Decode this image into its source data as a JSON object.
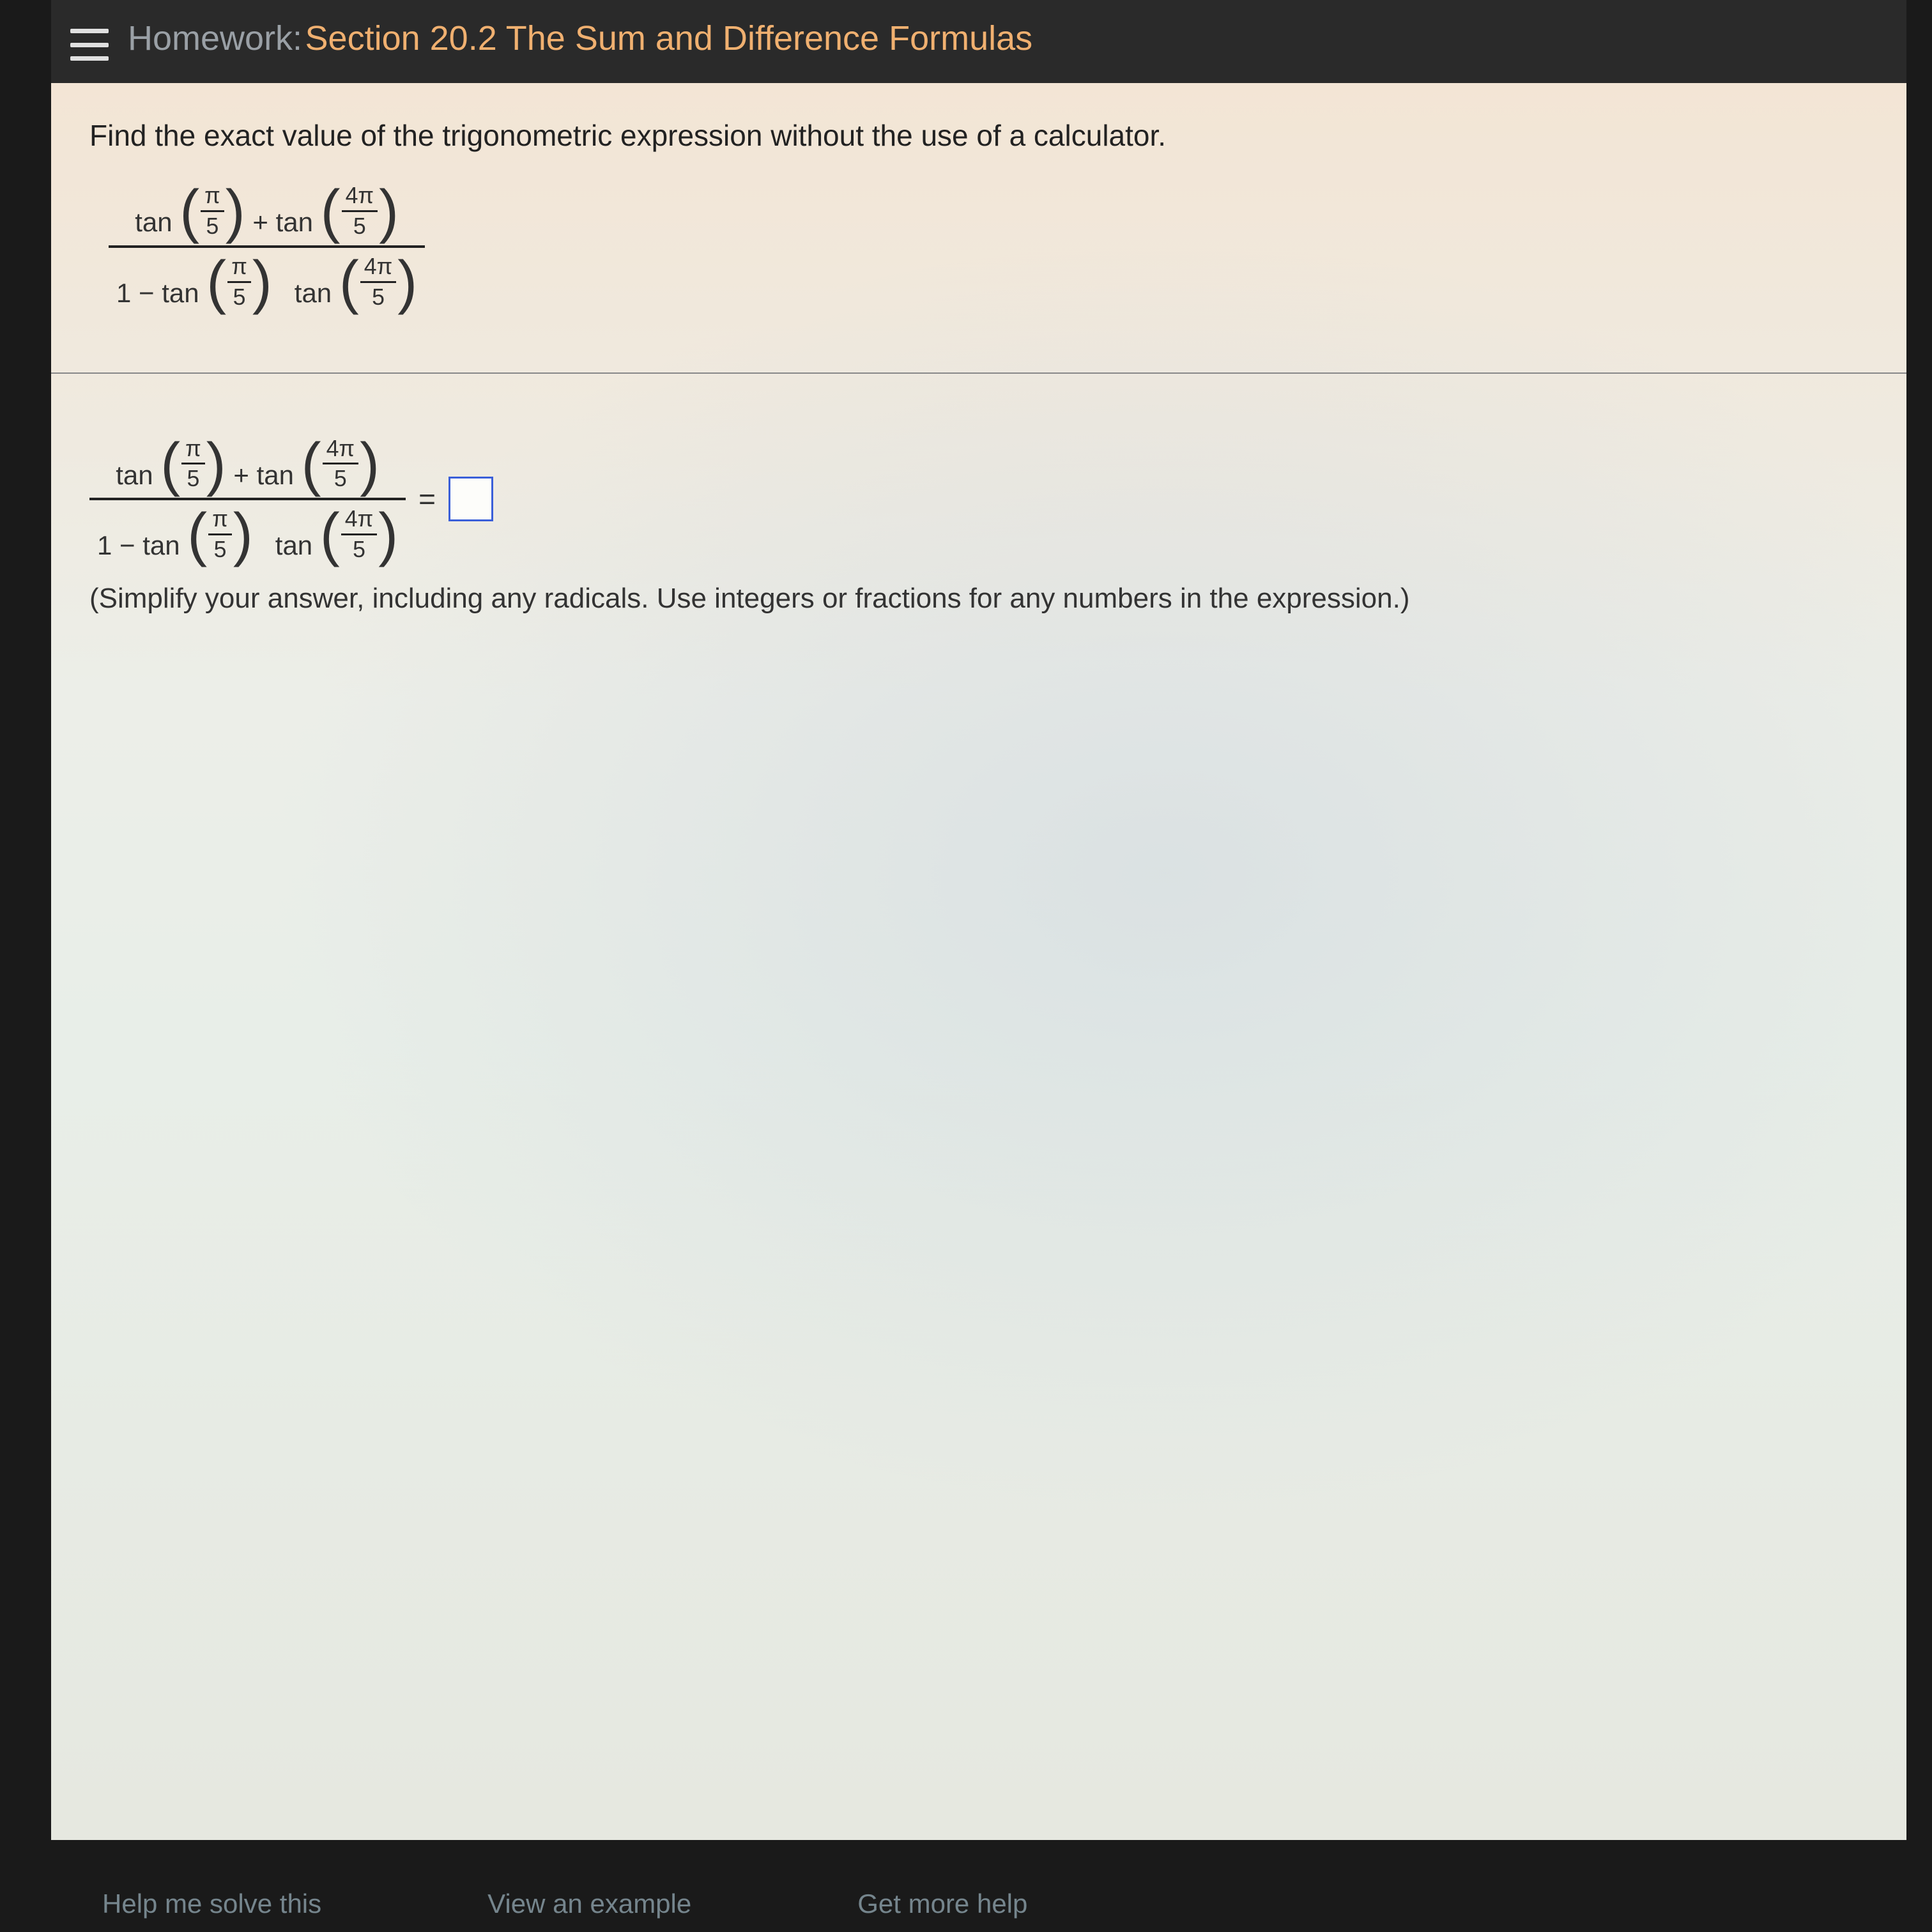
{
  "header": {
    "label": "Homework:",
    "title": "Section 20.2 The Sum and Difference Formulas"
  },
  "question": {
    "instruction": "Find the exact value of the trigonometric expression without the use of a calculator.",
    "expr": {
      "tan": "tan",
      "plus": " + ",
      "one_minus": "1 − ",
      "arg1_num": "π",
      "arg1_den": "5",
      "arg2_num": "4π",
      "arg2_den": "5"
    },
    "equals": " = ",
    "hint": "(Simplify your answer, including any radicals. Use integers or fractions for any numbers in the expression.)"
  },
  "footer": {
    "link1": "Help me solve this",
    "link2": "View an example",
    "link3": "Get more help"
  },
  "chart_data": {
    "type": "none",
    "note": "no chart in image"
  }
}
